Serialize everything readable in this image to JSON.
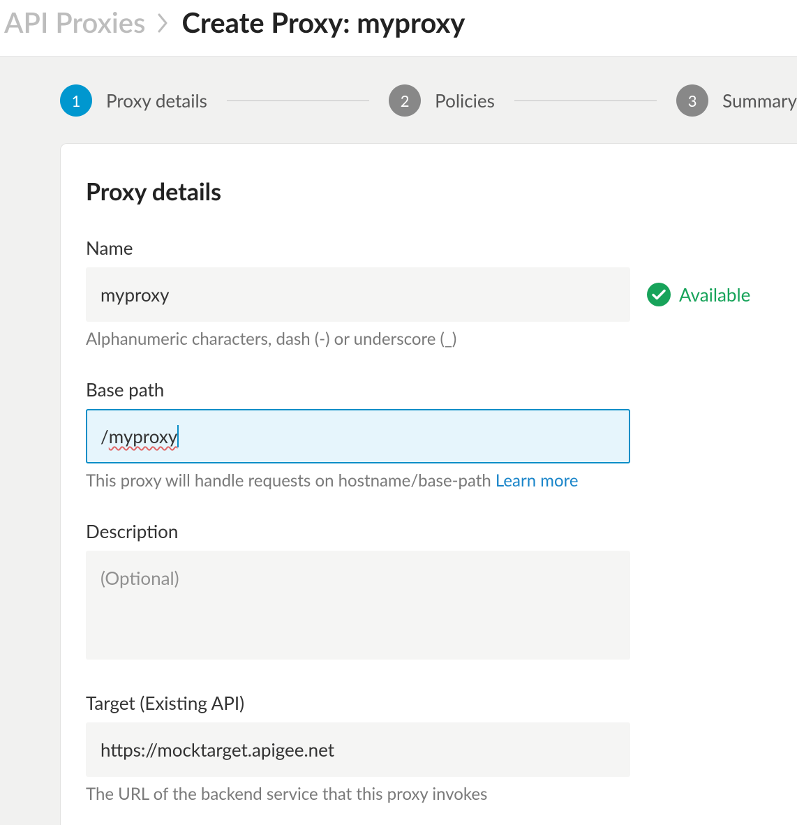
{
  "breadcrumb": {
    "parent": "API Proxies",
    "current": "Create Proxy: myproxy"
  },
  "stepper": {
    "steps": [
      {
        "num": "1",
        "label": "Proxy details"
      },
      {
        "num": "2",
        "label": "Policies"
      },
      {
        "num": "3",
        "label": "Summary"
      }
    ]
  },
  "panel": {
    "title": "Proxy details"
  },
  "fields": {
    "name": {
      "label": "Name",
      "value": "myproxy",
      "hint": "Alphanumeric characters, dash (-) or underscore (_)",
      "status": "Available"
    },
    "basepath": {
      "label": "Base path",
      "prefix": "/",
      "value": "myproxy",
      "hint": "This proxy will handle requests on hostname/base-path ",
      "learn": "Learn more"
    },
    "description": {
      "label": "Description",
      "placeholder": "(Optional)"
    },
    "target": {
      "label": "Target (Existing API)",
      "value": "https://mocktarget.apigee.net",
      "hint": "The URL of the backend service that this proxy invokes"
    }
  }
}
